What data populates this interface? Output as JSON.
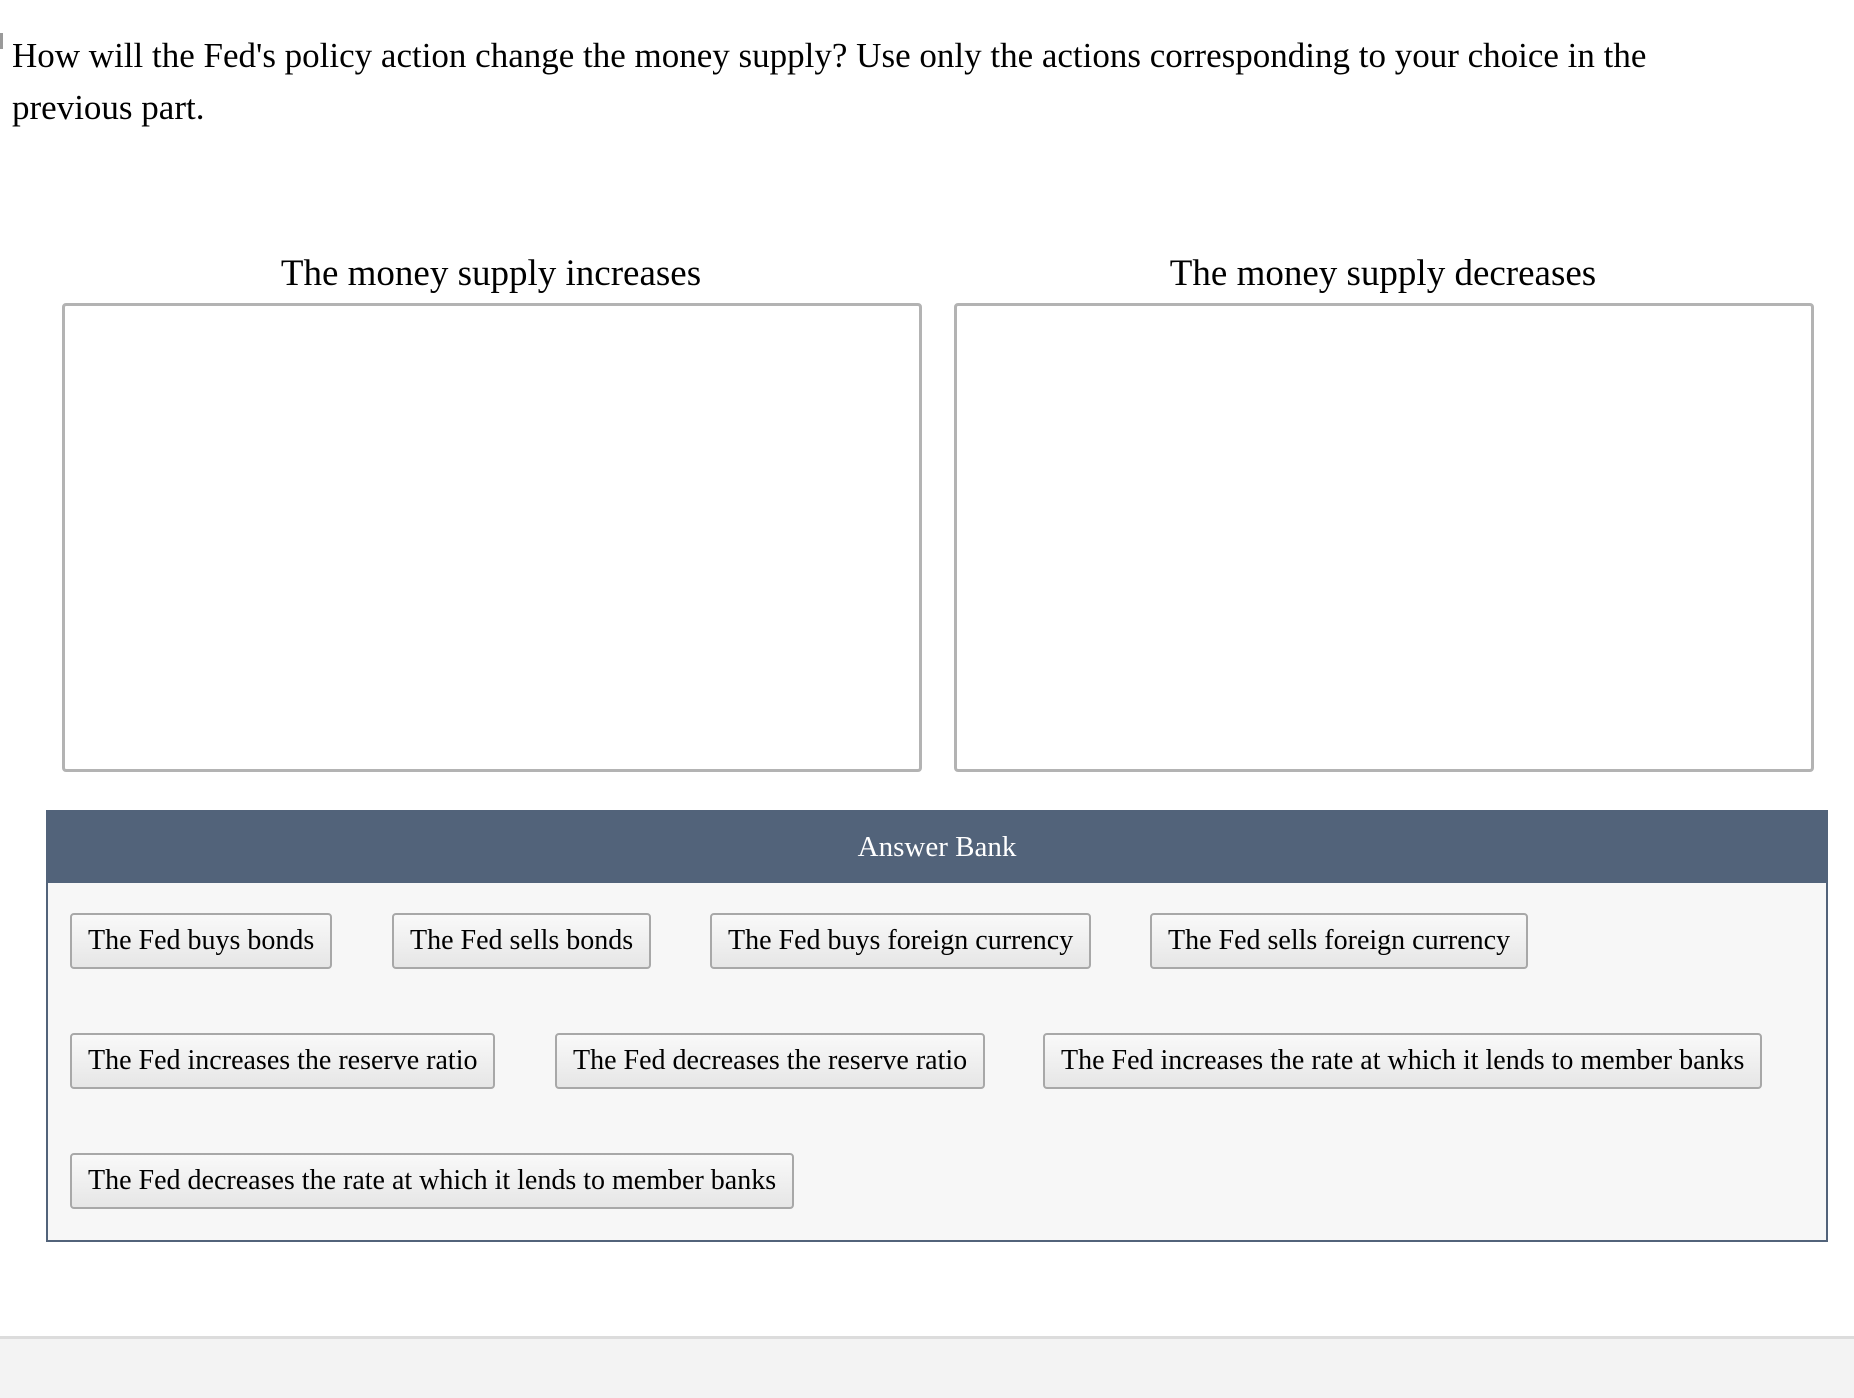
{
  "question": {
    "text": "How will the Fed's policy action change the money supply? Use only the actions corresponding to your choice in the previous part."
  },
  "bins": [
    {
      "title": "The money supply increases"
    },
    {
      "title": "The money supply decreases"
    }
  ],
  "answer_bank": {
    "title": "Answer Bank",
    "items": [
      "The Fed buys bonds",
      "The Fed sells bonds",
      "The Fed buys foreign currency",
      "The Fed sells foreign currency",
      "The Fed increases the reserve ratio",
      "The Fed decreases the reserve ratio",
      "The Fed increases the rate at which it lends to member banks",
      "The Fed decreases the rate at which it lends to member banks"
    ]
  },
  "colors": {
    "bank_header": "#52637a",
    "bank_background": "#f7f7f7",
    "bin_border": "#b3b3b3"
  }
}
